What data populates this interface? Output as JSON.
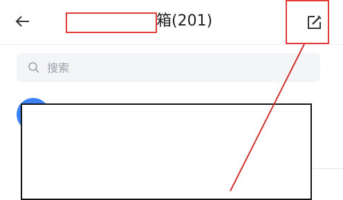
{
  "header": {
    "back_icon": "arrow-left-icon",
    "title": "的收件箱(201)",
    "compose_icon": "compose-edit-icon"
  },
  "search": {
    "placeholder": "搜索",
    "value": "",
    "icon": "search-icon"
  },
  "list": {
    "items": [
      {
        "title": "",
        "time": ""
      }
    ]
  },
  "annotation": {
    "highlight_color": "#e53935",
    "redaction_color": "#111111"
  }
}
